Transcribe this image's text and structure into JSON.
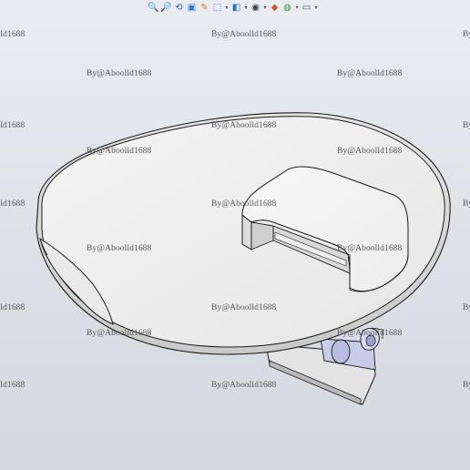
{
  "toolbar": {
    "icons": [
      {
        "name": "zoom-to-fit-icon",
        "glyph": "🔍",
        "color": "#1f5fb5"
      },
      {
        "name": "zoom-to-area-icon",
        "glyph": "🔎",
        "color": "#1f5fb5"
      },
      {
        "name": "previous-view-icon",
        "glyph": "⟲",
        "color": "#1f5fb5"
      },
      {
        "name": "section-view-icon",
        "glyph": "▣",
        "color": "#2a7ad0"
      },
      {
        "name": "dynamic-annotation-icon",
        "glyph": "✎",
        "color": "#c87a12"
      },
      {
        "name": "view-orientation-icon",
        "glyph": "⬚",
        "color": "#2a6fc0"
      },
      {
        "name": "display-style-icon",
        "glyph": "◧",
        "color": "#2a6fc0"
      },
      {
        "name": "hide-show-items-icon",
        "glyph": "◉",
        "color": "#3a3a3a"
      },
      {
        "name": "edit-appearance-icon",
        "glyph": "◆",
        "color": "#d0572a"
      },
      {
        "name": "apply-scene-icon",
        "glyph": "◍",
        "color": "#3d9a3d"
      },
      {
        "name": "view-settings-icon",
        "glyph": "▭",
        "color": "#444c57"
      }
    ]
  },
  "watermark": {
    "text": "By@Aboolld1688"
  },
  "colors": {
    "viewport_top": "#e9ecf1",
    "viewport_bottom": "#d3d7de",
    "part_face": "#f0f0f0",
    "part_edge": "#1b1b1b",
    "bracket_face": "#c9cce8"
  }
}
